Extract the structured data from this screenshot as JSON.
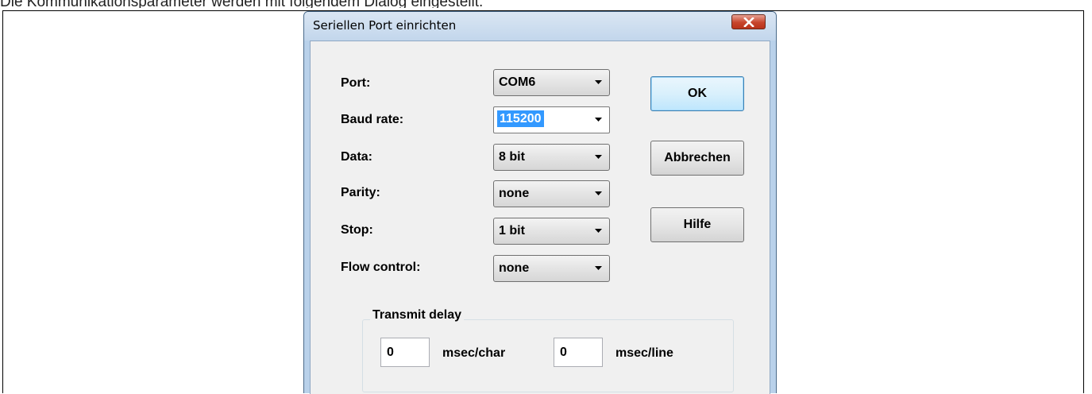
{
  "background_text": "Die Kommunikationsparameter werden mit folgendem Dialog eingestellt.",
  "dialog": {
    "title": "Seriellen Port einrichten",
    "fields": [
      {
        "label": "Port:",
        "value": "COM6"
      },
      {
        "label": "Baud rate:",
        "value": "115200"
      },
      {
        "label": "Data:",
        "value": "8 bit"
      },
      {
        "label": "Parity:",
        "value": "none"
      },
      {
        "label": "Stop:",
        "value": "1 bit"
      },
      {
        "label": "Flow control:",
        "value": "none"
      }
    ],
    "buttons": {
      "ok": "OK",
      "cancel": "Abbrechen",
      "help": "Hilfe"
    },
    "transmit_delay": {
      "title": "Transmit delay",
      "char_value": "0",
      "char_unit": "msec/char",
      "line_value": "0",
      "line_unit": "msec/line"
    }
  },
  "colors": {
    "titlebar": "#c2d6ec",
    "close_button": "#c7452c",
    "selection": "#3399ff",
    "dialog_face": "#f0f0f0"
  }
}
